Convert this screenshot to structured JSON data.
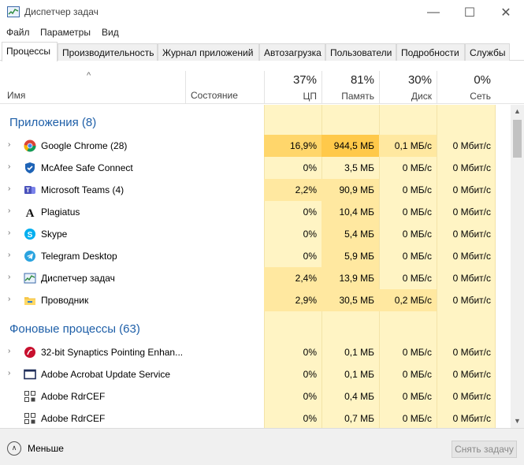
{
  "window": {
    "title": "Диспетчер задач",
    "minimize_glyph": "—",
    "maximize_glyph": "☐",
    "close_glyph": "✕"
  },
  "menu": [
    "Файл",
    "Параметры",
    "Вид"
  ],
  "tabs": [
    "Процессы",
    "Производительность",
    "Журнал приложений",
    "Автозагрузка",
    "Пользователи",
    "Подробности",
    "Службы"
  ],
  "active_tab": "Процессы",
  "header": {
    "sort_arrow": "^",
    "name": "Имя",
    "state": "Состояние",
    "cpu": {
      "pct": "37%",
      "label": "ЦП"
    },
    "memory": {
      "pct": "81%",
      "label": "Память"
    },
    "disk": {
      "pct": "30%",
      "label": "Диск"
    },
    "network": {
      "pct": "0%",
      "label": "Сеть"
    }
  },
  "groups": {
    "apps": {
      "title": "Приложения (8)"
    },
    "background": {
      "title": "Фоновые процессы (63)"
    }
  },
  "apps": [
    {
      "name": "Google Chrome (28)",
      "icon": "chrome-icon",
      "cpu": "16,9%",
      "mem": "944,5 МБ",
      "disk": "0,1 МБ/с",
      "net": "0 Мбит/с",
      "expand": "›"
    },
    {
      "name": "McAfee Safe Connect",
      "icon": "mcafee-icon",
      "cpu": "0%",
      "mem": "3,5 МБ",
      "disk": "0 МБ/с",
      "net": "0 Мбит/с",
      "expand": "›"
    },
    {
      "name": "Microsoft Teams (4)",
      "icon": "teams-icon",
      "cpu": "2,2%",
      "mem": "90,9 МБ",
      "disk": "0 МБ/с",
      "net": "0 Мбит/с",
      "expand": "›"
    },
    {
      "name": "Plagiatus",
      "icon": "plagiatus-icon",
      "cpu": "0%",
      "mem": "10,4 МБ",
      "disk": "0 МБ/с",
      "net": "0 Мбит/с",
      "expand": "›"
    },
    {
      "name": "Skype",
      "icon": "skype-icon",
      "cpu": "0%",
      "mem": "5,4 МБ",
      "disk": "0 МБ/с",
      "net": "0 Мбит/с",
      "expand": "›"
    },
    {
      "name": "Telegram Desktop",
      "icon": "telegram-icon",
      "cpu": "0%",
      "mem": "5,9 МБ",
      "disk": "0 МБ/с",
      "net": "0 Мбит/с",
      "expand": "›"
    },
    {
      "name": "Диспетчер задач",
      "icon": "task-manager-icon",
      "cpu": "2,4%",
      "mem": "13,9 МБ",
      "disk": "0 МБ/с",
      "net": "0 Мбит/с",
      "expand": "›"
    },
    {
      "name": "Проводник",
      "icon": "explorer-folder-icon",
      "cpu": "2,9%",
      "mem": "30,5 МБ",
      "disk": "0,2 МБ/с",
      "net": "0 Мбит/с",
      "expand": "›"
    }
  ],
  "background": [
    {
      "name": "32-bit Synaptics Pointing Enhan...",
      "icon": "synaptics-icon",
      "cpu": "0%",
      "mem": "0,1 МБ",
      "disk": "0 МБ/с",
      "net": "0 Мбит/с",
      "expand": "›"
    },
    {
      "name": "Adobe Acrobat Update Service",
      "icon": "service-window-icon",
      "cpu": "0%",
      "mem": "0,1 МБ",
      "disk": "0 МБ/с",
      "net": "0 Мбит/с",
      "expand": "›"
    },
    {
      "name": "Adobe RdrCEF",
      "icon": "generic-app-icon",
      "cpu": "0%",
      "mem": "0,4 МБ",
      "disk": "0 МБ/с",
      "net": "0 Мбит/с",
      "expand": ""
    },
    {
      "name": "Adobe RdrCEF",
      "icon": "generic-app-icon",
      "cpu": "0%",
      "mem": "0,7 МБ",
      "disk": "0 МБ/с",
      "net": "0 Мбит/с",
      "expand": ""
    }
  ],
  "scrollbar": {
    "up": "▲",
    "down": "▼"
  },
  "footer": {
    "less_glyph": "∧",
    "less_label": "Меньше",
    "end_task": "Снять задачу"
  },
  "colors": {
    "group_title": "#1e5fa8",
    "heat_light": "#fff4c4",
    "heat_mid": "#ffe8a0",
    "heat_strong": "#ffd66b"
  }
}
